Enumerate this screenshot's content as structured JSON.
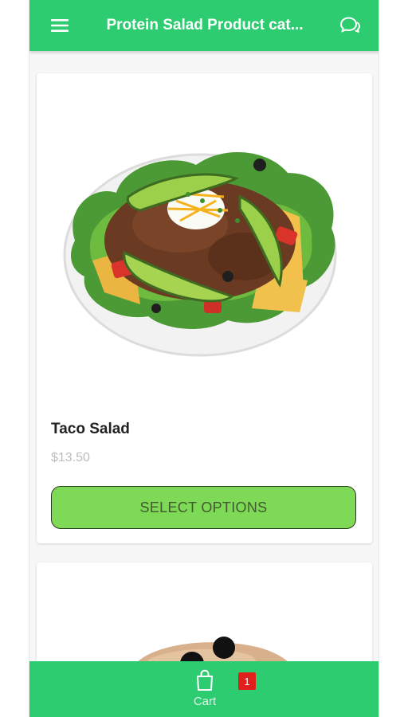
{
  "header": {
    "title": "Protein Salad Product cat...",
    "menu_icon": "hamburger-menu-icon",
    "chat_icon": "chat-bubbles-icon"
  },
  "products": [
    {
      "name": "Taco Salad",
      "price": "$13.50",
      "button_label": "SELECT OPTIONS"
    }
  ],
  "bottom_bar": {
    "cart_label": "Cart",
    "cart_icon": "shopping-bag-icon",
    "cart_count": "1"
  },
  "colors": {
    "primary": "#2dcc70",
    "button": "#7ed957",
    "badge": "#e0201b"
  }
}
